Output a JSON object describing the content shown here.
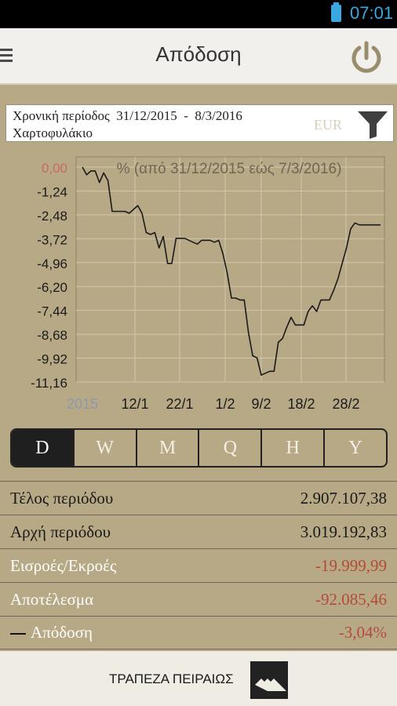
{
  "status_bar": {
    "time": "07:01",
    "battery_icon": "battery-icon"
  },
  "app_bar": {
    "title": "Απόδοση",
    "menu_icon": "menu-icon",
    "power_icon": "power-icon"
  },
  "filter": {
    "period_label": "Χρονική περίοδος",
    "period_start": "31/12/2015",
    "period_sep": "-",
    "period_end": "8/3/2016",
    "portfolio_label": "Χαρτοφυλάκιο",
    "currency": "EUR",
    "filter_icon": "funnel-icon"
  },
  "chart_data": {
    "type": "line",
    "title": "% (από 31/12/2015 εώς 7/3/2016)",
    "y_ticks": [
      "0,00",
      "-1,24",
      "-2,48",
      "-3,72",
      "-4,96",
      "-6,20",
      "-7,44",
      "-8,68",
      "-9,92",
      "-11,16"
    ],
    "x_ticks": [
      "2015",
      "12/1",
      "22/1",
      "1/2",
      "9/2",
      "18/2",
      "28/2"
    ],
    "ylim": [
      -11.16,
      0
    ],
    "grid": true,
    "series": [
      {
        "line_color": "#1a1a1a",
        "x": [
          0,
          1,
          2,
          3,
          4,
          5,
          6,
          7,
          8,
          9,
          10,
          11,
          12,
          13,
          14,
          15,
          16,
          17,
          18,
          19,
          20,
          21,
          22,
          23,
          24,
          25,
          26,
          27,
          28,
          29,
          30,
          31,
          32,
          33,
          34,
          35,
          36,
          37,
          38,
          39,
          40,
          41,
          42,
          43,
          44,
          45,
          46,
          47,
          48,
          49,
          50,
          51,
          52,
          53,
          54,
          55,
          56,
          57,
          58,
          59,
          60,
          61,
          62,
          63,
          64,
          65,
          66,
          67,
          68,
          69,
          70
        ],
        "values": [
          0.0,
          -0.4,
          -0.2,
          -0.2,
          -0.8,
          -0.3,
          -0.7,
          -2.3,
          -2.3,
          -2.3,
          -2.3,
          -2.4,
          -2.2,
          -2.0,
          -2.4,
          -3.4,
          -3.5,
          -3.4,
          -4.2,
          -3.6,
          -5.0,
          -5.0,
          -3.7,
          -3.7,
          -3.7,
          -3.8,
          -3.9,
          -4.0,
          -3.8,
          -3.8,
          -3.8,
          -3.9,
          -3.8,
          -4.5,
          -5.5,
          -6.8,
          -6.8,
          -6.9,
          -6.9,
          -8.6,
          -9.8,
          -9.9,
          -10.8,
          -10.7,
          -10.6,
          -10.6,
          -9.1,
          -8.9,
          -8.3,
          -7.8,
          -8.2,
          -8.2,
          -8.2,
          -7.5,
          -7.2,
          -7.5,
          -6.9,
          -6.9,
          -6.9,
          -6.4,
          -5.8,
          -5.0,
          -4.2,
          -3.2,
          -2.9,
          -3.0,
          -3.0,
          -3.0,
          -3.0,
          -3.0,
          -3.0
        ]
      }
    ]
  },
  "tabs": [
    {
      "label": "D",
      "active": true
    },
    {
      "label": "W",
      "active": false
    },
    {
      "label": "M",
      "active": false
    },
    {
      "label": "Q",
      "active": false
    },
    {
      "label": "H",
      "active": false
    },
    {
      "label": "Y",
      "active": false
    }
  ],
  "summary": {
    "end_label": "Τέλος περιόδου",
    "end_value": "2.907.107,38",
    "start_label": "Αρχή περιόδου",
    "start_value": "3.019.192,83",
    "flows_label": "Εισροές/Εκροές",
    "flows_value": "-19.999,99",
    "result_label": "Αποτέλεσμα",
    "result_value": "-92.085,46",
    "return_label": "Απόδοση",
    "return_value": "-3,04%"
  },
  "footer": {
    "bank_name": "ΤΡΑΠΕΖΑ ΠΕΙΡΑΙΩΣ",
    "logo_icon": "bank-logo-icon"
  }
}
